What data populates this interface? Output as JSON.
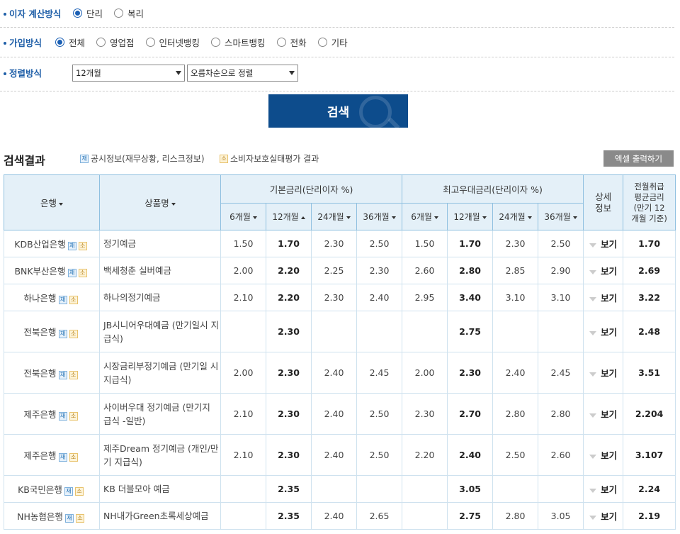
{
  "filters": {
    "interest_method": {
      "label": "이자 계산방식",
      "options": [
        {
          "label": "단리",
          "checked": true
        },
        {
          "label": "복리",
          "checked": false
        }
      ]
    },
    "join_method": {
      "label": "가입방식",
      "options": [
        {
          "label": "전체",
          "checked": true
        },
        {
          "label": "영업점",
          "checked": false
        },
        {
          "label": "인터넷뱅킹",
          "checked": false
        },
        {
          "label": "스마트뱅킹",
          "checked": false
        },
        {
          "label": "전화",
          "checked": false
        },
        {
          "label": "기타",
          "checked": false
        }
      ]
    },
    "sort_method": {
      "label": "정렬방식",
      "period_value": "12개월",
      "order_value": "오름차순으로 정렬"
    }
  },
  "search_button": "검색",
  "results": {
    "title": "검색결과",
    "legend_disclosure": "공시정보(재무상황, 리스크정보)",
    "legend_consumer": "소비자보호실태평가 결과",
    "badge_disclosure": "재",
    "badge_consumer": "소",
    "excel_button": "엑셀 출력하기"
  },
  "table": {
    "headers": {
      "bank": "은행",
      "product": "상품명",
      "base_rate": "기본금리(단리이자 %)",
      "max_rate": "최고우대금리(단리이자 %)",
      "detail": "상세\n정보",
      "avg": "전월취급\n평균금리\n(만기 12\n개월 기준)"
    },
    "periods": [
      "6개월",
      "12개월",
      "24개월",
      "36개월"
    ],
    "detail_label": "보기",
    "rows": [
      {
        "bank": "KDB산업은행",
        "product": "정기예금",
        "base": [
          "1.50",
          "1.70",
          "2.30",
          "2.50"
        ],
        "max": [
          "1.50",
          "1.70",
          "2.30",
          "2.50"
        ],
        "avg": "1.70"
      },
      {
        "bank": "BNK부산은행",
        "product": "백세청춘 실버예금",
        "base": [
          "2.00",
          "2.20",
          "2.25",
          "2.30"
        ],
        "max": [
          "2.60",
          "2.80",
          "2.85",
          "2.90"
        ],
        "avg": "2.69"
      },
      {
        "bank": "하나은행",
        "product": "하나의정기예금",
        "base": [
          "2.10",
          "2.20",
          "2.30",
          "2.40"
        ],
        "max": [
          "2.95",
          "3.40",
          "3.10",
          "3.10"
        ],
        "avg": "3.22"
      },
      {
        "bank": "전북은행",
        "product": "JB시니어우대예금 (만기일시 지급식)",
        "base": [
          "",
          "2.30",
          "",
          ""
        ],
        "max": [
          "",
          "2.75",
          "",
          ""
        ],
        "avg": "2.48"
      },
      {
        "bank": "전북은행",
        "product": "시장금리부정기예금 (만기일 시지급식)",
        "base": [
          "2.00",
          "2.30",
          "2.40",
          "2.45"
        ],
        "max": [
          "2.00",
          "2.30",
          "2.40",
          "2.45"
        ],
        "avg": "3.51"
      },
      {
        "bank": "제주은행",
        "product": "사이버우대 정기예금 (만기지 급식 -일반)",
        "base": [
          "2.10",
          "2.30",
          "2.40",
          "2.50"
        ],
        "max": [
          "2.30",
          "2.70",
          "2.80",
          "2.80"
        ],
        "avg": "2.204"
      },
      {
        "bank": "제주은행",
        "product": "제주Dream 정기예금 (개인/만 기 지급식)",
        "base": [
          "2.10",
          "2.30",
          "2.40",
          "2.50"
        ],
        "max": [
          "2.20",
          "2.40",
          "2.50",
          "2.60"
        ],
        "avg": "3.107"
      },
      {
        "bank": "KB국민은행",
        "product": "KB 더블모아 예금",
        "base": [
          "",
          "2.35",
          "",
          ""
        ],
        "max": [
          "",
          "3.05",
          "",
          ""
        ],
        "avg": "2.24"
      },
      {
        "bank": "NH농협은행",
        "product": "NH내가Green초록세상예금",
        "base": [
          "",
          "2.35",
          "2.40",
          "2.65"
        ],
        "max": [
          "",
          "2.75",
          "2.80",
          "3.05"
        ],
        "avg": "2.19"
      }
    ]
  }
}
